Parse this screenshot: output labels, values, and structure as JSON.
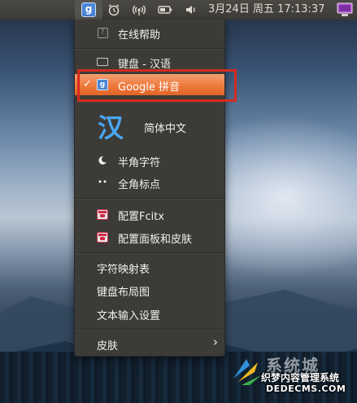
{
  "panel": {
    "ime_tray_letter": "g",
    "clock": "3月24日 周五 17:13:37",
    "icons": [
      "fcitx-google-pinyin-icon",
      "alarm-clock-icon",
      "wireless-icon",
      "battery-icon",
      "volume-icon",
      "power-icon"
    ]
  },
  "menu": {
    "help": "在线帮助",
    "keyboard_layout": "键盘 - 汉语",
    "google_pinyin": "Google 拼音",
    "simplified_glyph": "汉",
    "simplified": "简体中文",
    "half_width": "半角字符",
    "full_width_punct": "全角标点",
    "config_fcitx": "配置Fcitx",
    "config_panel_skin": "配置面板和皮肤",
    "char_map": "字符映射表",
    "keyboard_layout_chart": "键盘布局图",
    "text_input_settings": "文本输入设置",
    "skin": "皮肤",
    "check_mark": "✓",
    "submenu_arrow": "›",
    "help_icon_glyph": "?"
  },
  "watermark": {
    "big": "系统城",
    "line1": "织梦内容管理系统",
    "line2": "DEDECMS.COM"
  },
  "colors": {
    "selected_bg": "#ee7a3d",
    "menu_bg": "#3c3b37",
    "annotation": "#d42a1e",
    "han_glyph": "#4aa6f2"
  }
}
